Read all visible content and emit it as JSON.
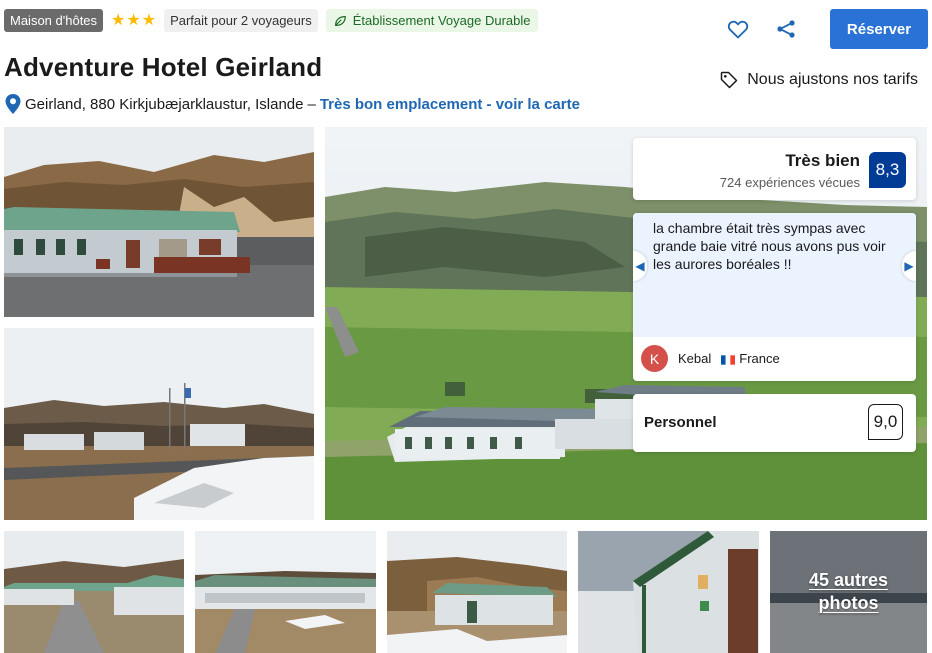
{
  "header": {
    "property_type": "Maison d'hôtes",
    "star_count": 3,
    "guests_badge": "Parfait pour 2 voyageurs",
    "eco_badge": "Établissement Voyage Durable",
    "reserve_label": "Réserver",
    "price_note": "Nous ajustons nos tarifs"
  },
  "hotel": {
    "name": "Adventure Hotel Geirland",
    "address": "Geirland, 880 Kirkjubæjarklaustur, Islande",
    "separator": "–",
    "location_link": "Très bon emplacement - voir la carte"
  },
  "rating": {
    "word": "Très bien",
    "count_text": "724 expériences vécues",
    "score": "8,3"
  },
  "review": {
    "text": "la chambre était très sympas avec grande baie vitré nous avons pus voir les aurores boréales !!",
    "initial": "K",
    "author": "Kebal",
    "country": "France"
  },
  "staff": {
    "label": "Personnel",
    "score": "9,0"
  },
  "gallery": {
    "more_photos_line1": "45 autres",
    "more_photos_line2": "photos"
  },
  "colors": {
    "brand_blue": "#003b95",
    "button_blue": "#2b72d6",
    "link_blue": "#1f67b3",
    "star_yellow": "#febb02",
    "eco_green": "#1c6b28"
  },
  "icons": [
    "heart-icon",
    "share-icon",
    "price-tag-icon",
    "location-pin-icon",
    "leaf-icon",
    "chevron-left-icon",
    "chevron-right-icon",
    "star-icon"
  ]
}
